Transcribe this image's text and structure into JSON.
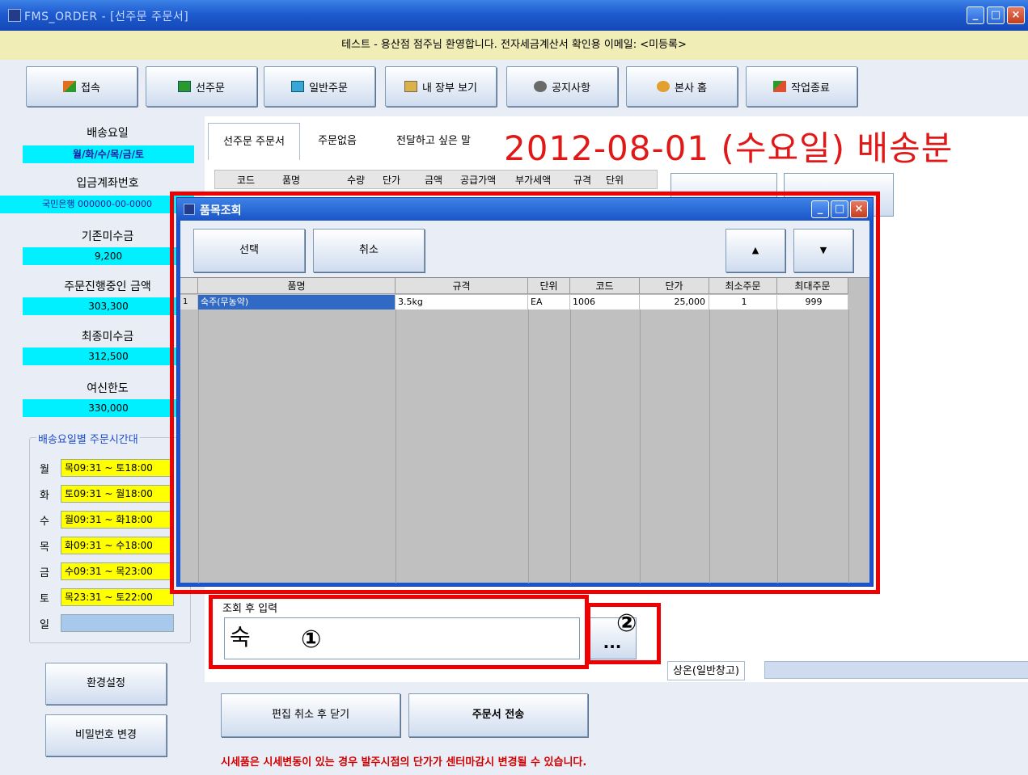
{
  "window": {
    "title": "FMS_ORDER - [선주문 주문서]",
    "welcome": "테스트 - 용산점 점주님 환영합니다.   전자세금계산서 확인용 이메일: <미등록>"
  },
  "toolbar": {
    "connect": "접속",
    "preorder": "선주문",
    "general_order": "일반주문",
    "my_ledger": "내 장부 보기",
    "notice": "공지사항",
    "hq_home": "본사 홈",
    "exit": "작업종료"
  },
  "left": {
    "delivery_day_label": "배송요일",
    "delivery_day_value": "월/화/수/목/금/토",
    "account_label": "입금계좌번호",
    "account_value": "국민은행 000000-00-0000",
    "prev_unpaid_label": "기존미수금",
    "prev_unpaid_value": "9,200",
    "in_progress_label": "주문진행중인 금액",
    "in_progress_value": "303,300",
    "final_unpaid_label": "최종미수금",
    "final_unpaid_value": "312,500",
    "credit_label": "여신한도",
    "credit_value": "330,000",
    "schedule_title": "배송요일별 주문시간대",
    "schedule": [
      {
        "day": "월",
        "time": "목09:31 ~ 토18:00"
      },
      {
        "day": "화",
        "time": "토09:31 ~ 월18:00"
      },
      {
        "day": "수",
        "time": "월09:31 ~ 화18:00"
      },
      {
        "day": "목",
        "time": "화09:31 ~ 수18:00"
      },
      {
        "day": "금",
        "time": "수09:31 ~ 목23:00"
      },
      {
        "day": "토",
        "time": "목23:31 ~ 토22:00"
      },
      {
        "day": "일",
        "time": ""
      }
    ],
    "settings": "환경설정",
    "change_password": "비밀번호 변경"
  },
  "main": {
    "tabs": [
      "선주문 주문서",
      "주문없음",
      "전달하고 싶은 말"
    ],
    "date_banner": "2012-08-01 (수요일) 배송분",
    "grid_headers": [
      "코드",
      "품명",
      "수량",
      "단가",
      "금액",
      "공급가액",
      "부가세액",
      "규격",
      "단위"
    ],
    "input_label": "조회 후 입력",
    "input_value": "숙",
    "dots": "...",
    "bottom_tab": "상온(일반창고)",
    "cancel_close": "편집 취소 후 닫기",
    "send_order": "주문서 전송",
    "notice": "시세품은 시세변동이 있는 경우 발주시점의 단가가 센터마감시 변경될 수 있습니다."
  },
  "dialog": {
    "title": "품목조회",
    "select": "선택",
    "cancel": "취소",
    "up": "▲",
    "down": "▼",
    "columns": [
      "품명",
      "규격",
      "단위",
      "코드",
      "단가",
      "최소주문",
      "최대주문"
    ],
    "row": {
      "index": "1",
      "name": "숙주(무농약)",
      "spec": "3.5kg",
      "unit": "EA",
      "code": "1006",
      "price": "25,000",
      "min": "1",
      "max": "999"
    }
  },
  "annotations": {
    "one": "①",
    "two": "②"
  }
}
